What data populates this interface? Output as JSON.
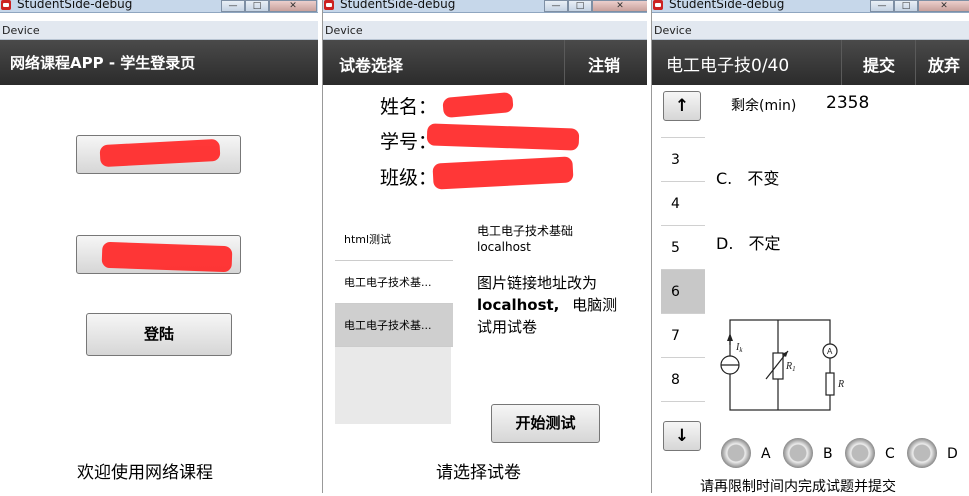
{
  "windows": [
    {
      "title": "StudentSide-debug",
      "device_label": "Device"
    },
    {
      "title": "StudentSide-debug",
      "device_label": "Device"
    },
    {
      "title": "StudentSide-debug",
      "device_label": "Device"
    }
  ],
  "login": {
    "header": "网络课程APP - 学生登录页",
    "login_button": "登陆",
    "welcome": "欢迎使用网络课程"
  },
  "select": {
    "header": "试卷选择",
    "logout": "注销",
    "name_label": "姓名：",
    "id_label": "学号：",
    "class_label": "班级：",
    "papers": [
      "html测试",
      "电工电子技术基...",
      "电工电子技术基..."
    ],
    "detail_title": "电工电子技术基础",
    "detail_host": "localhost",
    "note_1": "图片链接地址改为",
    "note_host": "localhost,",
    "note_2": "电脑测",
    "note_3": "试用试卷",
    "start_button": "开始测试",
    "hint": "请选择试卷"
  },
  "exam": {
    "header": "电工电子技0/40",
    "submit": "提交",
    "give_up": "放弃",
    "remaining_label": "剩余(min)",
    "remaining_value": "2358",
    "up_icon": "↑",
    "down_icon": "↓",
    "numbers": [
      "3",
      "4",
      "5",
      "6",
      "7",
      "8"
    ],
    "option_c": "C.",
    "option_c_text": "不变",
    "option_d": "D.",
    "option_d_text": "不定",
    "circuit_labels": {
      "current": "I",
      "current_sub": "k",
      "resistor1": "R",
      "resistor1_sub": "1",
      "ammeter": "A",
      "resistor": "R"
    },
    "radio_labels": [
      "A",
      "B",
      "C",
      "D"
    ],
    "footer": "请再限制时间内完成试题并提交"
  }
}
